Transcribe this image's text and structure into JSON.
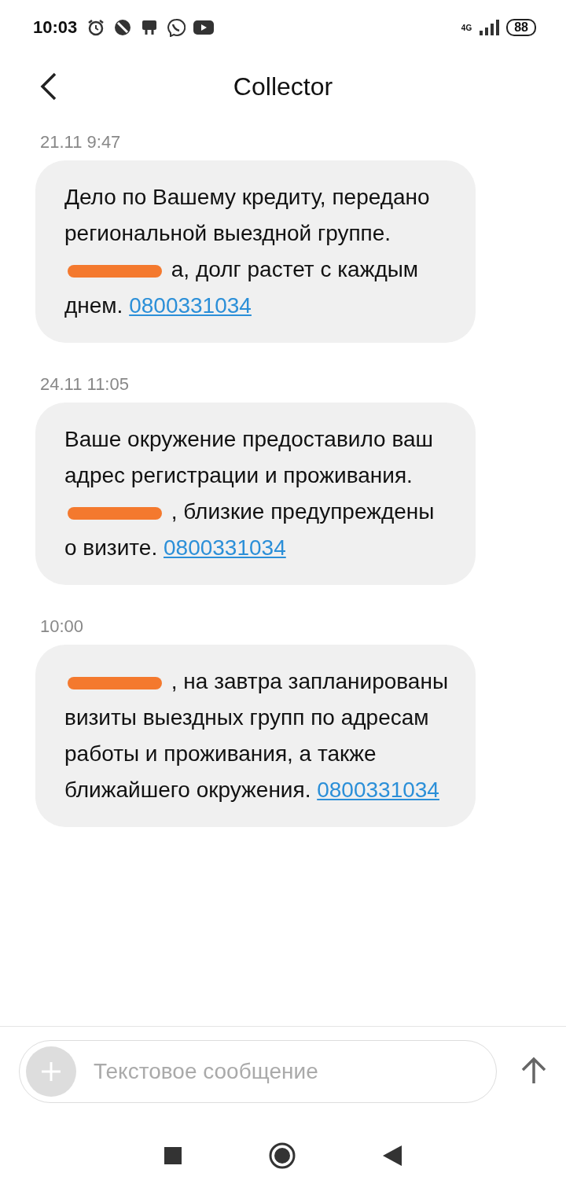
{
  "status_bar": {
    "time": "10:03",
    "network": "4G",
    "battery": "88"
  },
  "header": {
    "title": "Collector"
  },
  "messages": [
    {
      "time": "21.11 9:47",
      "parts": [
        {
          "kind": "text",
          "text": "Дело по Вашему кредиту, передано региональной выездной группе."
        },
        {
          "kind": "redaction"
        },
        {
          "kind": "text",
          "text": "а, долг растет с каждым днем."
        }
      ],
      "link": "0800331034"
    },
    {
      "time": "24.11 11:05",
      "parts": [
        {
          "kind": "text",
          "text": "Ваше окружение предоставило ваш адрес регистрации и проживания."
        },
        {
          "kind": "redaction"
        },
        {
          "kind": "text",
          "text": ", близкие предупреждены о визите."
        }
      ],
      "link": "0800331034"
    },
    {
      "time": "10:00",
      "parts": [
        {
          "kind": "redaction"
        },
        {
          "kind": "text",
          "text": ", на завтра запланированы визиты выездных групп по адресам работы и проживания, а также ближайшего окружения."
        }
      ],
      "link": "0800331034"
    }
  ],
  "composer": {
    "placeholder": "Текстовое сообщение"
  }
}
